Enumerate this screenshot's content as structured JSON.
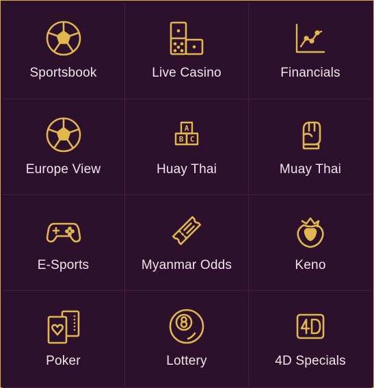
{
  "menu": {
    "items": [
      {
        "label": "Sportsbook",
        "icon": "soccer-ball-icon"
      },
      {
        "label": "Live Casino",
        "icon": "domino-icon"
      },
      {
        "label": "Financials",
        "icon": "line-chart-icon"
      },
      {
        "label": "Europe View",
        "icon": "soccer-ball-icon"
      },
      {
        "label": "Huay Thai",
        "icon": "abc-blocks-icon"
      },
      {
        "label": "Muay Thai",
        "icon": "boxing-glove-icon"
      },
      {
        "label": "E-Sports",
        "icon": "gamepad-icon"
      },
      {
        "label": "Myanmar Odds",
        "icon": "ticket-icon"
      },
      {
        "label": "Keno",
        "icon": "strawberry-icon"
      },
      {
        "label": "Poker",
        "icon": "playing-cards-icon"
      },
      {
        "label": "Lottery",
        "icon": "eight-ball-icon"
      },
      {
        "label": "4D Specials",
        "icon": "4d-badge-icon"
      }
    ]
  },
  "colors": {
    "accent": "#e0b84e",
    "background": "#2c102c",
    "divider": "#3f1d3f",
    "text": "#f1e6ea"
  }
}
